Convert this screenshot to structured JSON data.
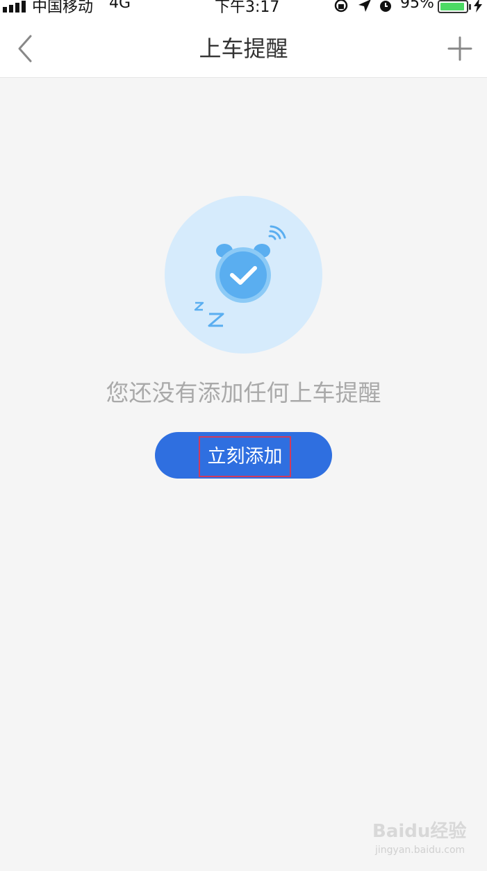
{
  "status_bar": {
    "carrier": "中国移动",
    "network": "4G",
    "time": "下午3:17",
    "battery_percent": "95%",
    "battery_level": 0.95,
    "icons": [
      "signal-icon",
      "rotation-lock-icon",
      "location-icon",
      "alarm-icon",
      "battery-icon",
      "charging-icon"
    ]
  },
  "nav": {
    "title": "上车提醒",
    "back_icon": "chevron-left-icon",
    "add_icon": "plus-icon"
  },
  "empty_state": {
    "illustration": "alarm-clock-icon",
    "message": "您还没有添加任何上车提醒",
    "button_label": "立刻添加"
  },
  "watermark": {
    "brand": "Baidu经验",
    "url": "jingyan.baidu.com"
  },
  "colors": {
    "primary": "#2f6fe0",
    "illustration_bg": "#d6ebfc",
    "illustration_blue": "#5aaef0",
    "highlight_border": "#d23a5a",
    "background": "#f5f5f5"
  }
}
